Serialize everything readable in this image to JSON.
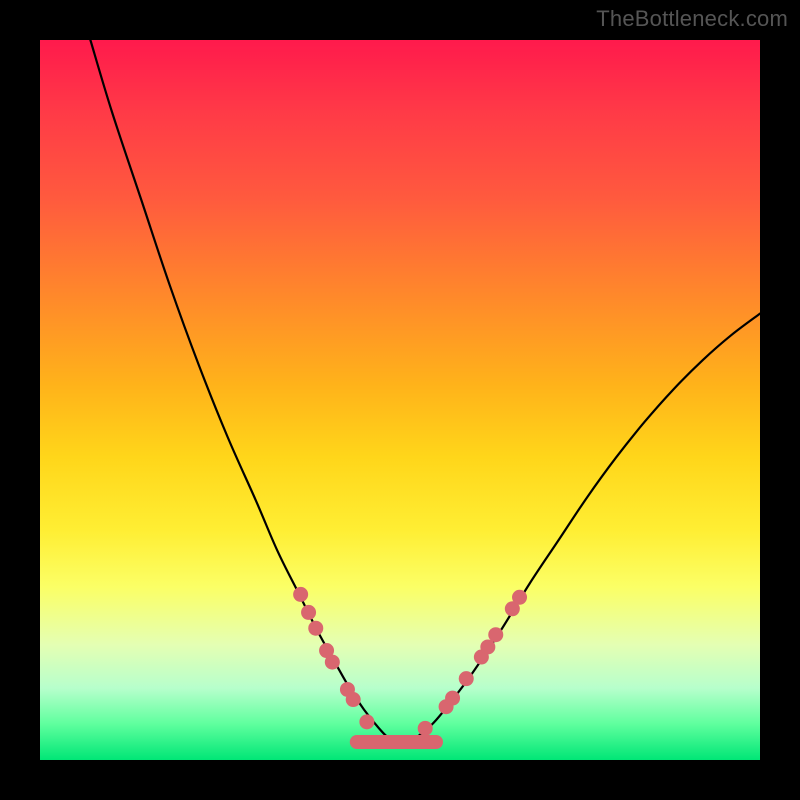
{
  "watermark": "TheBottleneck.com",
  "chart_data": {
    "type": "line",
    "title": "",
    "xlabel": "",
    "ylabel": "",
    "xlim": [
      0,
      100
    ],
    "ylim": [
      0,
      100
    ],
    "grid": false,
    "series": [
      {
        "name": "bottleneck-curve",
        "color": "#000000",
        "x": [
          7,
          10,
          14,
          18,
          22,
          26,
          30,
          33,
          36,
          38.5,
          41,
          43,
          45,
          47,
          48.5,
          50,
          52,
          54.5,
          57,
          60,
          64,
          68,
          72,
          76,
          80,
          84,
          88,
          92,
          96,
          100
        ],
        "y": [
          100,
          90,
          78,
          66,
          55,
          45,
          36,
          29,
          23,
          18,
          13.5,
          10,
          7,
          4.5,
          3,
          2.5,
          3,
          5,
          8,
          12,
          18,
          24.5,
          30.5,
          36.5,
          42,
          47,
          51.5,
          55.5,
          59,
          62
        ]
      },
      {
        "name": "flat-segment",
        "color": "#d9666f",
        "x": [
          44,
          55
        ],
        "y": [
          2.5,
          2.5
        ]
      }
    ],
    "marker_groups": [
      {
        "name": "left-cluster",
        "color": "#d9666f",
        "points": [
          {
            "x": 36.2,
            "y": 23.0
          },
          {
            "x": 37.3,
            "y": 20.5
          },
          {
            "x": 38.3,
            "y": 18.3
          },
          {
            "x": 39.8,
            "y": 15.2
          },
          {
            "x": 40.6,
            "y": 13.6
          },
          {
            "x": 42.7,
            "y": 9.8
          },
          {
            "x": 43.5,
            "y": 8.4
          },
          {
            "x": 45.4,
            "y": 5.3
          }
        ]
      },
      {
        "name": "right-cluster",
        "color": "#d9666f",
        "points": [
          {
            "x": 53.5,
            "y": 4.4
          },
          {
            "x": 56.4,
            "y": 7.4
          },
          {
            "x": 57.3,
            "y": 8.6
          },
          {
            "x": 59.2,
            "y": 11.3
          },
          {
            "x": 61.3,
            "y": 14.3
          },
          {
            "x": 62.2,
            "y": 15.7
          },
          {
            "x": 63.3,
            "y": 17.4
          },
          {
            "x": 65.6,
            "y": 21.0
          },
          {
            "x": 66.6,
            "y": 22.6
          }
        ]
      }
    ]
  }
}
